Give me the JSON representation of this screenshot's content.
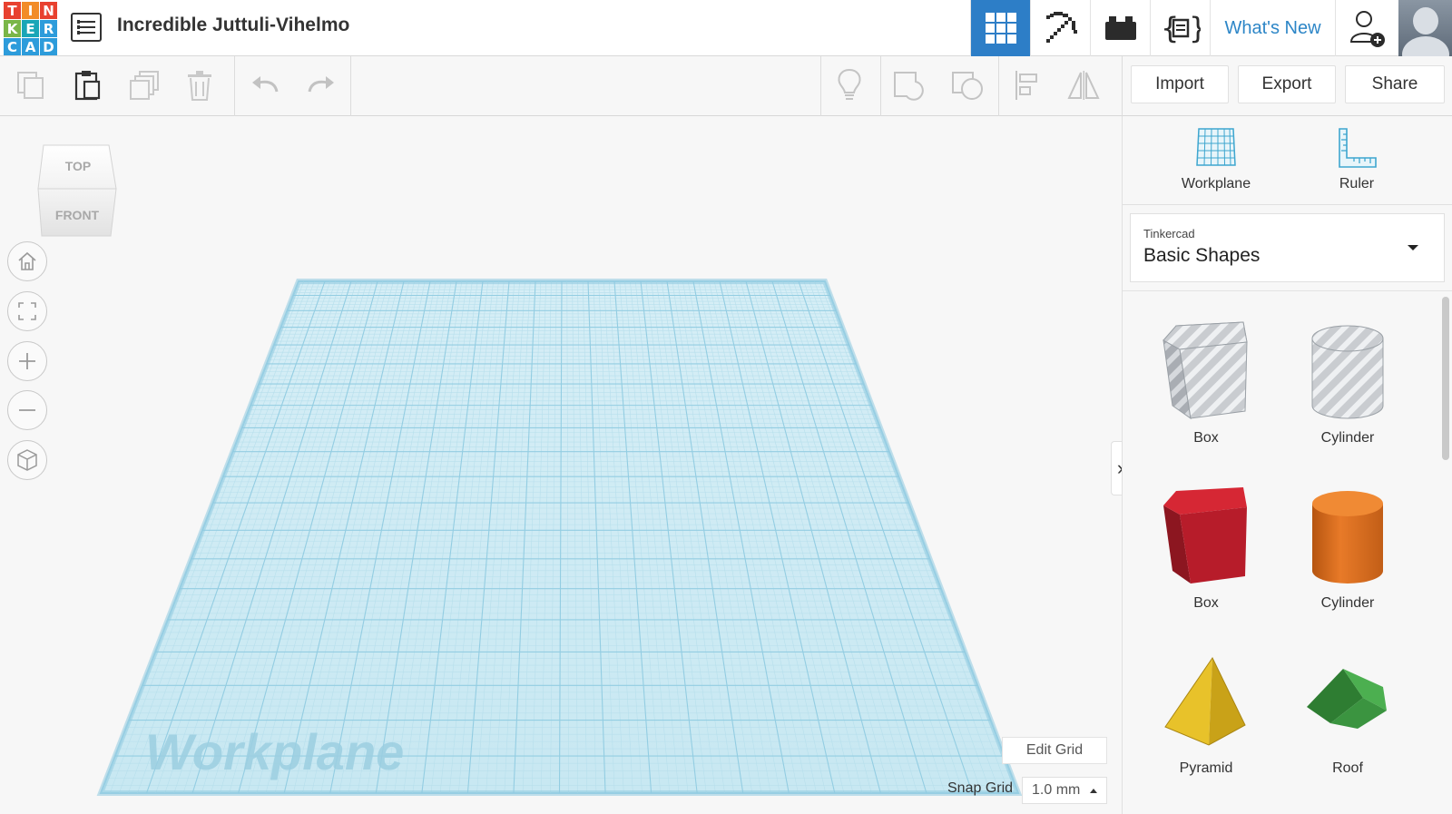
{
  "header": {
    "logo_letters": [
      "T",
      "I",
      "N",
      "K",
      "E",
      "R",
      "C",
      "A",
      "D"
    ],
    "design_title": "Incredible Juttuli-Vihelmo",
    "whats_new": "What's New",
    "accent": "#2d7ec7"
  },
  "toolbar": {
    "import_label": "Import",
    "export_label": "Export",
    "share_label": "Share"
  },
  "viewport": {
    "viewcube_top": "TOP",
    "viewcube_front": "FRONT",
    "workplane_label": "Workplane",
    "edit_grid_label": "Edit Grid",
    "snap_grid_label": "Snap Grid",
    "snap_grid_value": "1.0 mm",
    "grid_color": "#a7dced"
  },
  "panel": {
    "workplane_label": "Workplane",
    "ruler_label": "Ruler",
    "library_source": "Tinkercad",
    "library_name": "Basic Shapes",
    "shapes": [
      {
        "label": "Box",
        "kind": "box-hole"
      },
      {
        "label": "Cylinder",
        "kind": "cylinder-hole"
      },
      {
        "label": "Box",
        "kind": "box-red"
      },
      {
        "label": "Cylinder",
        "kind": "cylinder-orange"
      },
      {
        "label": "Pyramid",
        "kind": "pyramid-yellow"
      },
      {
        "label": "Roof",
        "kind": "roof-green"
      }
    ]
  }
}
